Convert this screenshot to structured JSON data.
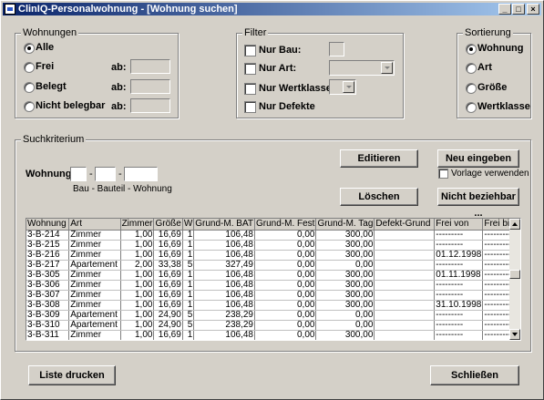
{
  "window": {
    "title": "ClinIQ-Personalwohnung - [Wohnung suchen]",
    "buttons": {
      "minimize": "_",
      "maximize": "□",
      "close": "×"
    }
  },
  "wohnungen": {
    "legend": "Wohnungen",
    "options": [
      "Alle",
      "Frei",
      "Belegt",
      "Nicht belegbar"
    ],
    "selected": "Alle",
    "ab_label": "ab:"
  },
  "filter": {
    "legend": "Filter",
    "nur_bau": "Nur Bau:",
    "nur_art": "Nur Art:",
    "nur_wertklasse": "Nur Wertklasse:",
    "nur_defekte": "Nur Defekte"
  },
  "sortierung": {
    "legend": "Sortierung",
    "options": [
      "Wohnung",
      "Art",
      "Größe",
      "Wertklasse"
    ],
    "selected": "Wohnung"
  },
  "suchkriterium": {
    "legend": "Suchkriterium",
    "wohnung_label": "Wohnung:",
    "sep": "-",
    "hint": "Bau - Bauteil - Wohnung"
  },
  "buttons": {
    "editieren": "Editieren",
    "neu_eingeben": "Neu eingeben",
    "vorlage": "Vorlage verwenden",
    "loeschen": "Löschen",
    "nicht_beziehbar": "Nicht beziehbar ...",
    "liste_drucken": "Liste drucken",
    "schliessen": "Schließen"
  },
  "table": {
    "columns": [
      "Wohnung",
      "Art",
      "Zimmer",
      "Größe",
      "W",
      "Grund-M. BAT",
      "Grund-M. Fest",
      "Grund-M. Tag",
      "Defekt-Grund",
      "Frei von",
      "Frei bis"
    ],
    "rows": [
      [
        "3-B-214",
        "Zimmer",
        "1,00",
        "16,69",
        "1",
        "106,48",
        "0,00",
        "300,00",
        "",
        "---------",
        "---------"
      ],
      [
        "3-B-215",
        "Zimmer",
        "1,00",
        "16,69",
        "1",
        "106,48",
        "0,00",
        "300,00",
        "",
        "---------",
        "---------"
      ],
      [
        "3-B-216",
        "Zimmer",
        "1,00",
        "16,69",
        "1",
        "106,48",
        "0,00",
        "300,00",
        "",
        "01.12.1998",
        "---------"
      ],
      [
        "3-B-217",
        "Apartement",
        "2,00",
        "33,38",
        "5",
        "327,49",
        "0,00",
        "0,00",
        "",
        "---------",
        "---------"
      ],
      [
        "3-B-305",
        "Zimmer",
        "1,00",
        "16,69",
        "1",
        "106,48",
        "0,00",
        "300,00",
        "",
        "01.11.1998",
        "---------"
      ],
      [
        "3-B-306",
        "Zimmer",
        "1,00",
        "16,69",
        "1",
        "106,48",
        "0,00",
        "300,00",
        "",
        "---------",
        "---------"
      ],
      [
        "3-B-307",
        "Zimmer",
        "1,00",
        "16,69",
        "1",
        "106,48",
        "0,00",
        "300,00",
        "",
        "---------",
        "---------"
      ],
      [
        "3-B-308",
        "Zimmer",
        "1,00",
        "16,69",
        "1",
        "106,48",
        "0,00",
        "300,00",
        "",
        "31.10.1998",
        "---------"
      ],
      [
        "3-B-309",
        "Apartement",
        "1,00",
        "24,90",
        "5",
        "238,29",
        "0,00",
        "0,00",
        "",
        "---------",
        "---------"
      ],
      [
        "3-B-310",
        "Apartement",
        "1,00",
        "24,90",
        "5",
        "238,29",
        "0,00",
        "0,00",
        "",
        "---------",
        "---------"
      ],
      [
        "3-B-311",
        "Zimmer",
        "1,00",
        "16,69",
        "1",
        "106,48",
        "0,00",
        "300,00",
        "",
        "---------",
        "---------"
      ]
    ]
  }
}
